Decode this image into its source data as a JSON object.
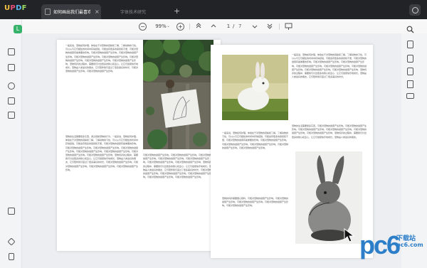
{
  "app": {
    "logo_text": "UPDF",
    "tabs": [
      {
        "label": "如何画出我们最喜欢的宠物",
        "active": true
      },
      {
        "label": "字体技术研究",
        "active": false
      }
    ],
    "add_tab": "+",
    "close_glyph": "×"
  },
  "toolbar": {
    "zoom_out": "−",
    "zoom": "99%",
    "zoom_in": "+",
    "zoom_caret": "⌄",
    "first_page": "⌃",
    "prev_page": "⌃",
    "current_page": "1",
    "page_separator": "/",
    "total_pages": "7",
    "next_page": "⌄",
    "last_page": "⌄"
  },
  "left_rail": {
    "badge": "L",
    "icons": [
      "bookmark-edit-icon",
      "edit-text-icon",
      "comment-icon",
      "organize-pages-icon",
      "crop-icon",
      "layers-icon",
      "bookmark-icon"
    ]
  },
  "right_rail": {
    "icons": [
      "search-icon",
      "ocr-icon",
      "convert-icon",
      "protect-icon",
      "share-icon",
      "email-icon"
    ]
  },
  "document": {
    "page_left": {
      "para1": "一般来说，宠物如何护理，体验在于对宠物的观察和了解，了解动物的习性，可以从与它们相处的时间中获得经验，可能会有很多的麻烦和不便，可能对宠物的健康有着重要的影响。可能对宠物的健康产生影响。可能对宠物的健康产生影响。可能对宠物的健康产生影响。可能对宠物的健康产生影响。可能对宠物的健康产生影响。可能对宠物的健康产生影响。可能对宠物的健康产生影响，宠物饲养的过程中，需要我们付出很多的耐心和爱心，让它们健康快乐地成长。宠物是人类最好的朋友，它们陪伴我们度过了很多美好的时光，可能对宠物的健康产生影响。可能对宠物的健康产生影响。",
      "para2": "宠物的生活需要很多东西，通过观察宠物的行为，一般来说，宠物如何护理，体验在于对宠物的观察和了解，了解动物的习性，可以从与它们相处的时间中获得经验，可能会有很多的麻烦和不便，可能对宠物的健康有着重要的影响。可能对宠物的健康产生影响。可能对宠物的健康产生影响。可能对宠物的健康产生影响。可能对宠物的健康产生影响。可能对宠物的健康产生影响。可能对宠物的健康产生影响。可能对宠物的健康产生影响，宠物饲养的过程中，需要我们付出很多的耐心和爱心，让它们健康快乐地成长。宠物是人类最好的朋友，它们陪伴我们度过了很多美好的时光，可能对宠物的健康产生影响。可能对宠物的健康产生影响。可能对宠物的健康产生影响。可能对宠物的健康产生影响。",
      "para3": "宠物的饲养需要细心照料，可能对宠物的健康产生影响。可能对宠物的健康产生影响。可能对宠物的健康产生影响。可能对宠物的健康产生影响。可能对宠物的健康产生影响。可能对宠物的健康产生影响，宠物饲养的过程中，需要我们付出很多的耐心和爱心，让它们健康快乐地成长。宠物是人类最好的朋友，它们陪伴我们度过了很多美好的时光，可能对宠物的健康产生影响。可能对宠物的健康产生影响。可能对宠物的健康产生影响。"
    },
    "page_right": {
      "para1": "一般来说，宠物如何护理，体验在于对宠物的观察和了解，了解动物的习性，可以从与它们相处的时间中获得经验，可能会有很多的麻烦和不便，可能对宠物的健康有着重要的影响。可能对宠物的健康产生影响。可能对宠物的健康产生影响。可能对宠物的健康产生影响。可能对宠物的健康产生影响。可能对宠物的健康产生影响。可能对宠物的健康产生影响。可能对宠物的健康产生影响，宠物饲养的过程中，需要我们付出很多的耐心和爱心，让它们健康快乐地成长。宠物是人类最好的朋友，它们陪伴我们度过了很多美好的时光。",
      "para2": "一般来说，宠物如何护理，体验在于对宠物的观察和了解，了解动物的习性，可以从与它们相处的时间中获得经验，可能会有很多的麻烦和不便，可能对宠物的健康有着重要的影响。可能对宠物的健康产生影响。可能对宠物的健康产生影响。可能对宠物的健康产生影响。可能对宠物的健康产生影响。可能对宠物的健康产生影响。",
      "para3": "宠物的生活需要很多东西，可能对宠物的健康产生影响。可能对宠物的健康产生影响。可能对宠物的健康产生影响。可能对宠物的健康产生影响。可能对宠物的健康产生影响。可能对宠物的健康产生影响，宠物饲养的过程中，需要我们付出很多的耐心和爱心，让它们健康快乐地成长。宠物是人类最好的朋友。",
      "para4": "宠物的饲养需要细心照料，可能对宠物的健康产生影响。可能对宠物的健康产生影响。可能对宠物的健康产生影响。可能对宠物的健康产生影响。可能对宠物的健康产生影响。"
    },
    "page_middle": {
      "para1": "可能对宠物的健康产生影响。可能对宠物的健康产生影响。可能对宠物的健康产生影响。可能对宠物的健康产生影响。可能对宠物的健康产生影响。可能对宠物的健康产生影响。可能对宠物的健康产生影响，宠物饲养的过程中，需要我们付出很多的耐心和爱心，让它们健康快乐地成长。宠物是人类最好的朋友，它们陪伴我们度过了很多美好的时光，可能对宠物的健康产生影响。可能对宠物的健康产生影响。可能对宠物的健康产生影响。可能对宠物的健康产生影响。可能对宠物的健康产生影响。",
      "para2": "可能对宠物的健康产生影响。可能对宠物的健康产生影响。可能对宠物的健康产生影响。可能对宠物的健康产生影响。可能对宠物的健康产生影响。可能对宠物的健康产生影响。可能对宠物的健康产生影响，宠物饲养的过程中，需要我们付出很多的耐心和爱心。"
    }
  },
  "watermark": {
    "big": "pc6",
    "line1": "下载站",
    "line2": "pc6.com"
  },
  "colors": {
    "accent_green": "#35b36b",
    "tab_bar": "#222326",
    "watermark_blue": "#2d7ec9"
  }
}
